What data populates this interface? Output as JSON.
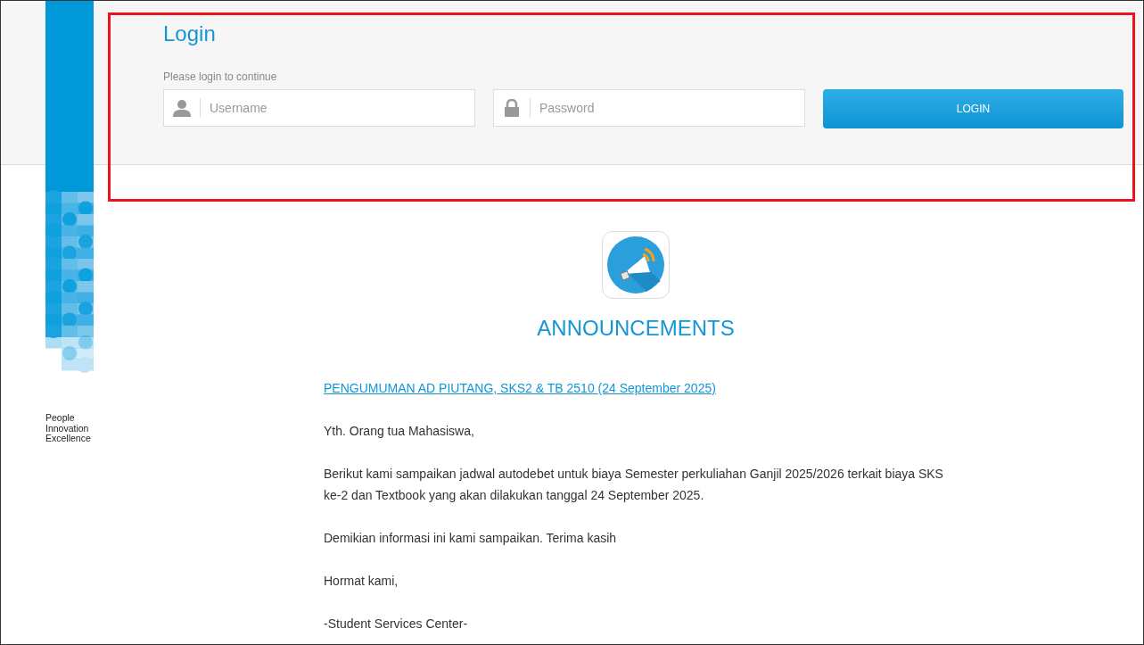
{
  "brand": {
    "tagline": [
      "People",
      "Innovation",
      "Excellence"
    ]
  },
  "login": {
    "title": "Login",
    "hint": "Please login to continue",
    "fields": [
      {
        "kind": "user",
        "placeholder": "Username"
      },
      {
        "kind": "password",
        "placeholder": "Password"
      }
    ],
    "button": "LOGIN"
  },
  "announcements": {
    "heading": "ANNOUNCEMENTS",
    "link": "PENGUMUMAN AD PIUTANG, SKS2 & TB 2510 (24 September 2025)",
    "paragraphs": [
      "Yth. Orang tua Mahasiswa,",
      "Berikut kami sampaikan jadwal autodebet untuk biaya Semester perkuliahan Ganjil 2025/2026 terkait biaya SKS ke-2 dan Textbook yang akan dilakukan tanggal 24 September 2025.",
      "Demikian informasi ini kami sampaikan. Terima kasih",
      "Hormat kami,",
      "-Student Services Center-"
    ]
  }
}
